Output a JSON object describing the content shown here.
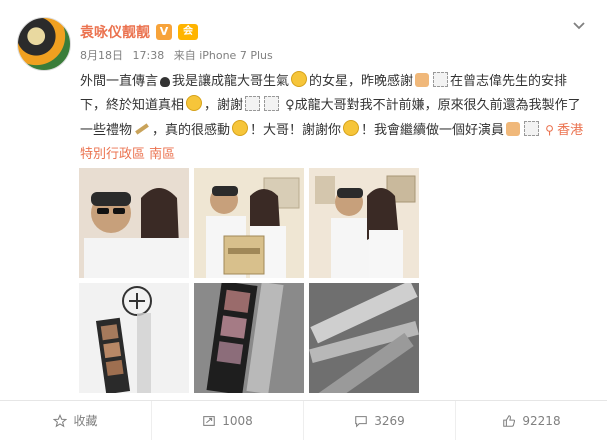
{
  "author": {
    "name": "袁咏仪靓靓",
    "verified_badge": "V",
    "member_badge": "会员"
  },
  "meta": {
    "date": "8月18日",
    "time": "17:38",
    "source": "来自 iPhone 7 Plus"
  },
  "post": {
    "segments": [
      {
        "t": "外間一直傳言"
      },
      {
        "icon": "lips"
      },
      {
        "t": "我是讓成龍大哥生氣"
      },
      {
        "icon": "sad-face"
      },
      {
        "t": "的女星，昨晚感謝"
      },
      {
        "icon": "praying-hands"
      },
      {
        "icon": "box"
      },
      {
        "t": "在曾志偉先生的安排下，終於知道真相"
      },
      {
        "icon": "sad-face"
      },
      {
        "t": "，謝謝"
      },
      {
        "icon": "box"
      },
      {
        "icon": "box"
      },
      {
        "t": " ♀成龍大哥對我不計前嫌，原來很久前還為我製作了一些禮物"
      },
      {
        "icon": "stick"
      },
      {
        "t": "，真的很感動"
      },
      {
        "icon": "sad-face"
      },
      {
        "t": "！大哥！謝謝你"
      },
      {
        "icon": "heart-eyes"
      },
      {
        "t": "！我會繼續做一個好演員"
      },
      {
        "icon": "flex-arm"
      },
      {
        "icon": "box"
      }
    ],
    "location": "香港特別行政區 南區"
  },
  "photos": [
    {
      "alt": "selfie-1"
    },
    {
      "alt": "gift-photo"
    },
    {
      "alt": "portrait"
    },
    {
      "alt": "film-strip-1"
    },
    {
      "alt": "film-strip-2"
    },
    {
      "alt": "film-strip-3"
    }
  ],
  "footer": {
    "favorite": "收藏",
    "repost": "1008",
    "comment": "3269",
    "like": "92218"
  },
  "colors": {
    "accent": "#eb7350",
    "meta": "#808080"
  }
}
